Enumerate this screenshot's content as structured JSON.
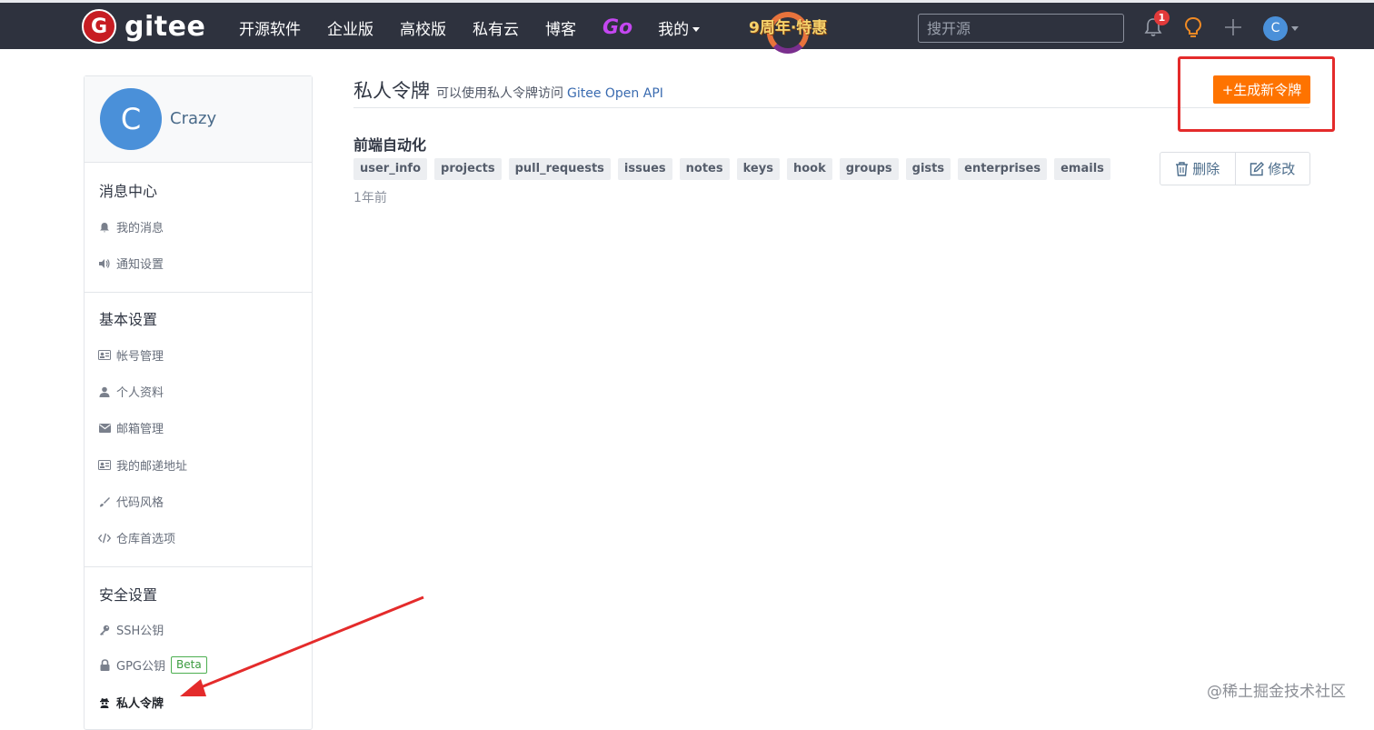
{
  "header": {
    "logo_glyph": "G",
    "logo_text": "gitee",
    "nav": [
      "开源软件",
      "企业版",
      "高校版",
      "私有云",
      "博客"
    ],
    "go_label": "Go",
    "mine_label": "我的",
    "promo_text": "9周年·特惠",
    "search_placeholder": "搜开源",
    "notification_count": "1",
    "avatar_letter": "C"
  },
  "sidebar": {
    "avatar_letter": "C",
    "username": "Crazy",
    "message_center": {
      "title": "消息中心",
      "items": [
        {
          "label": "我的消息",
          "icon": "bell-icon"
        },
        {
          "label": "通知设置",
          "icon": "volume-icon"
        }
      ]
    },
    "basic_settings": {
      "title": "基本设置",
      "items": [
        {
          "label": "帐号管理",
          "icon": "id-card-icon"
        },
        {
          "label": "个人资料",
          "icon": "user-icon"
        },
        {
          "label": "邮箱管理",
          "icon": "envelope-icon"
        },
        {
          "label": "我的邮递地址",
          "icon": "address-card-icon"
        },
        {
          "label": "代码风格",
          "icon": "brush-icon"
        },
        {
          "label": "仓库首选项",
          "icon": "code-icon"
        }
      ]
    },
    "security_settings": {
      "title": "安全设置",
      "items": [
        {
          "label": "SSH公钥",
          "icon": "key-icon"
        },
        {
          "label": "GPG公钥",
          "icon": "lock-icon",
          "badge": "Beta"
        },
        {
          "label": "私人令牌",
          "icon": "spy-icon",
          "active": true
        }
      ]
    }
  },
  "main": {
    "title": "私人令牌",
    "description": "可以使用私人令牌访问",
    "api_link": "Gitee Open API",
    "new_token_label": "+生成新令牌",
    "token": {
      "name": "前端自动化",
      "scopes": [
        "user_info",
        "projects",
        "pull_requests",
        "issues",
        "notes",
        "keys",
        "hook",
        "groups",
        "gists",
        "enterprises",
        "emails"
      ],
      "age": "1年前",
      "delete_label": "删除",
      "edit_label": "修改"
    }
  },
  "watermark": "@稀土掘金技术社区",
  "colors": {
    "topbar": "#2e323e",
    "brand_red": "#c71d23",
    "primary_button": "#fe7300",
    "annotation_red": "#e42b2b"
  }
}
